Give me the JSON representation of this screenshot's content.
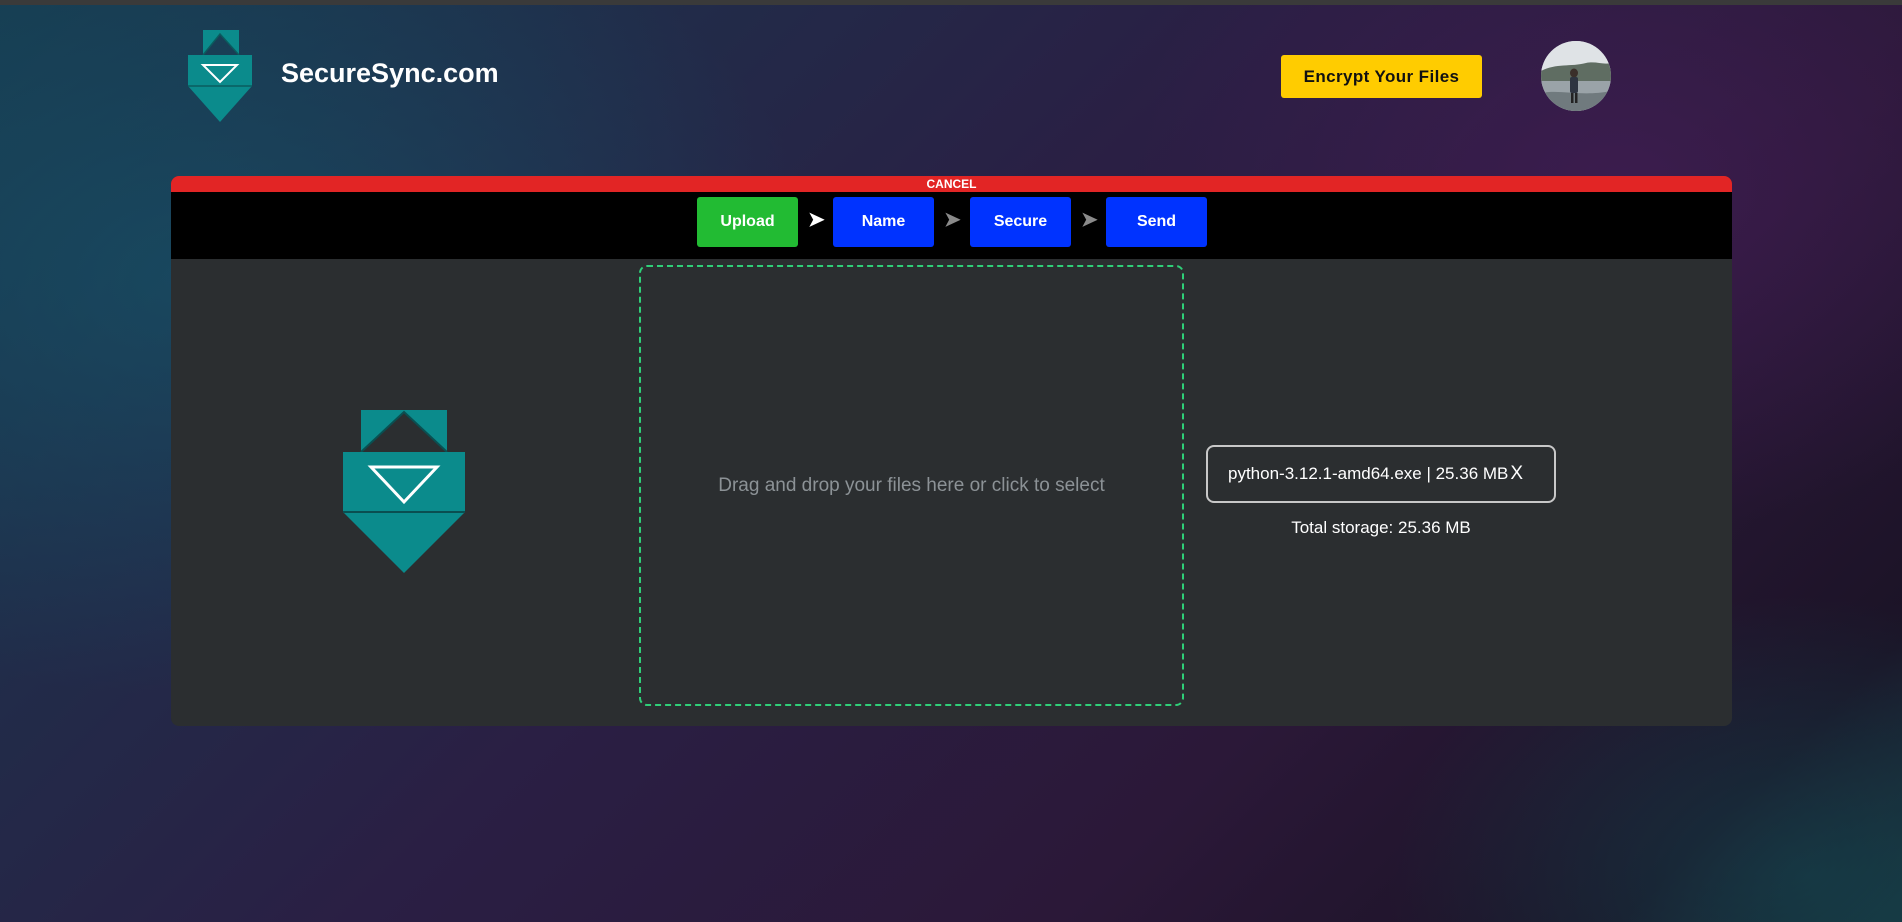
{
  "header": {
    "brand": "SecureSync.com",
    "encrypt_button": "Encrypt Your Files"
  },
  "upload_panel": {
    "cancel_label": "CANCEL",
    "steps": [
      {
        "label": "Upload",
        "state": "active",
        "color": "#22bb33"
      },
      {
        "label": "Name",
        "state": "pending",
        "color": "#0033ff"
      },
      {
        "label": "Secure",
        "state": "pending",
        "color": "#0033ff"
      },
      {
        "label": "Send",
        "state": "pending",
        "color": "#0033ff"
      }
    ],
    "dropzone_text": "Drag and drop your files here or click to select",
    "file_entry": "python-3.12.1-amd64.exe | 25.36 MB",
    "remove_glyph": "X",
    "total_storage": "Total storage: 25.36 MB"
  },
  "colors": {
    "accent_teal": "#0b8b8c",
    "cancel_red": "#e22525",
    "encrypt_yellow": "#ffcc00",
    "dropzone_border": "#2fcf78"
  },
  "icons": [
    "logo-icon",
    "chevron-right-icon",
    "upload-logo-icon",
    "close-icon"
  ]
}
